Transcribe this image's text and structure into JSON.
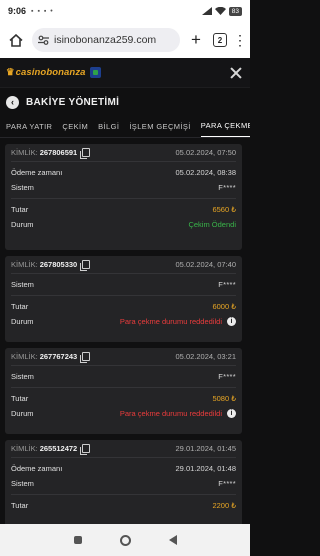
{
  "status_bar": {
    "time": "9:06",
    "icons_left": "▪ ▪ ▪ •",
    "battery": "83"
  },
  "browser": {
    "url": "isinobonanza259.com",
    "tab_count": "2"
  },
  "site": {
    "logo_text": "casinobonanza",
    "close_label": "close"
  },
  "page": {
    "title": "BAKİYE YÖNETİMİ"
  },
  "tabs": [
    {
      "label": "PARA YATIR"
    },
    {
      "label": "ÇEKİM"
    },
    {
      "label": "BİLGİ"
    },
    {
      "label": "İŞLEM GEÇMİŞİ"
    },
    {
      "label": "PARA ÇEKME DURUMU"
    }
  ],
  "labels": {
    "kimlik": "KİMLİK:",
    "odeme_zamani": "Ödeme zamanı",
    "sistem": "Sistem",
    "tutar": "Tutar",
    "durum": "Durum"
  },
  "transactions": [
    {
      "kimlik": "267806591",
      "date": "05.02.2024, 07:50",
      "odeme_zamani": "05.02.2024, 08:38",
      "sistem": "F****",
      "tutar": "6560 ₺",
      "durum": "Çekim Ödendi",
      "status_type": "paid"
    },
    {
      "kimlik": "267805330",
      "date": "05.02.2024, 07:40",
      "odeme_zamani": "",
      "sistem": "F****",
      "tutar": "6000 ₺",
      "durum": "Para çekme durumu reddedildi",
      "status_type": "rejected"
    },
    {
      "kimlik": "267767243",
      "date": "05.02.2024, 03:21",
      "odeme_zamani": "",
      "sistem": "F****",
      "tutar": "5080 ₺",
      "durum": "Para çekme durumu reddedildi",
      "status_type": "rejected"
    },
    {
      "kimlik": "265512472",
      "date": "29.01.2024, 01:45",
      "odeme_zamani": "29.01.2024, 01:48",
      "sistem": "F****",
      "tutar": "2200 ₺",
      "durum": "",
      "status_type": "paid"
    }
  ],
  "colors": {
    "accent_gold": "#e8a624",
    "success": "#39b54a",
    "danger": "#ea3c3c",
    "card_bg": "#242426",
    "page_bg": "#101011"
  }
}
